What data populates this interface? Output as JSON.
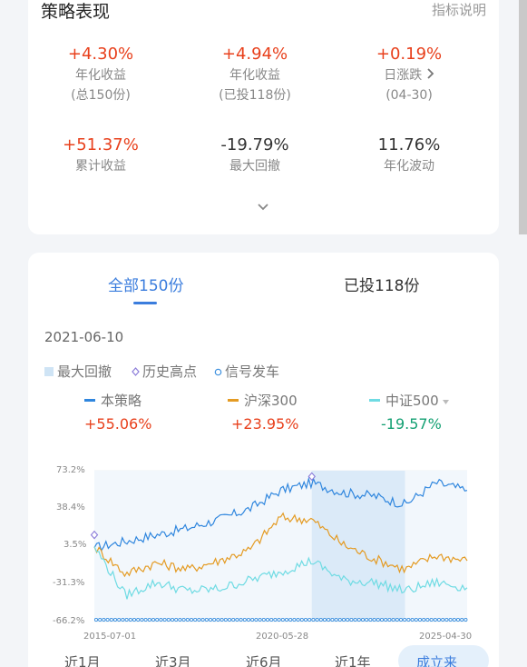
{
  "header": {
    "title": "策略表现",
    "link": "指标说明"
  },
  "metrics": [
    {
      "value": "+4.30%",
      "label": "年化收益",
      "sub": "(总150份)"
    },
    {
      "value": "+4.94%",
      "label": "年化收益",
      "sub": "(已投118份)"
    },
    {
      "value": "+0.19%",
      "label": "日涨跌",
      "sub": "(04-30)"
    },
    {
      "value": "+51.37%",
      "label": "累计收益"
    },
    {
      "value": "-19.79%",
      "label": "最大回撤"
    },
    {
      "value": "11.76%",
      "label": "年化波动"
    }
  ],
  "tabs": [
    {
      "label": "全部150份"
    },
    {
      "label": "已投118份"
    }
  ],
  "selected_date": "2021-06-10",
  "markers_legend": {
    "drawdown": "最大回撤",
    "high": "历史高点",
    "signal": "信号发车"
  },
  "series_legend": [
    {
      "name": "本策略",
      "value": "+55.06%",
      "color": "#2f86de"
    },
    {
      "name": "沪深300",
      "value": "+23.95%",
      "color": "#e49b23"
    },
    {
      "name": "中证500",
      "value": "-19.57%",
      "color": "#6fdbe3"
    }
  ],
  "periods": [
    "近1月",
    "近3月",
    "近6月",
    "近1年",
    "成立来"
  ],
  "colors": {
    "accent": "#3b7ddd",
    "positive": "#e8401c",
    "negative": "#14a073"
  },
  "chart_data": {
    "type": "line",
    "y_ticks": [
      "73.2%",
      "38.4%",
      "3.5%",
      "-31.3%",
      "-66.2%"
    ],
    "ylim": [
      -66.2,
      73.2
    ],
    "x_ticks": [
      "2015-07-01",
      "2020-05-28",
      "2025-04-30"
    ],
    "x": [
      "2015-07",
      "2016-07",
      "2017-07",
      "2018-07",
      "2019-07",
      "2020-05",
      "2021-01",
      "2021-06",
      "2022-06",
      "2023-06",
      "2024-02",
      "2024-09",
      "2025-04"
    ],
    "series": [
      {
        "name": "本策略",
        "values": [
          2,
          8,
          14,
          20,
          28,
          38,
          55,
          62,
          53,
          50,
          42,
          62,
          55
        ]
      },
      {
        "name": "沪深300",
        "values": [
          3,
          -22,
          -12,
          -18,
          -10,
          0,
          30,
          28,
          5,
          -8,
          -18,
          -5,
          -10
        ]
      },
      {
        "name": "中证500",
        "values": [
          3,
          -42,
          -30,
          -38,
          -36,
          -28,
          -20,
          -10,
          -28,
          -30,
          -38,
          -30,
          -35
        ]
      }
    ],
    "drawdown_range": [
      "2021-06",
      "2024-02"
    ],
    "history_high_points": [
      [
        "2015-07",
        8
      ],
      [
        "2021-06",
        62
      ]
    ]
  }
}
